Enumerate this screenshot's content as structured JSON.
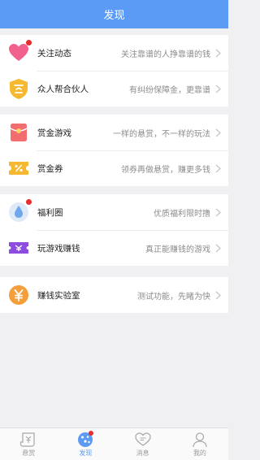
{
  "header": {
    "title": "发现"
  },
  "groups": [
    {
      "items": [
        {
          "title": "关注动态",
          "desc": "关注靠谱的人挣靠谱的钱",
          "icon": "heart-icon",
          "badge": true
        },
        {
          "title": "众人帮合伙人",
          "desc": "有纠纷保障金，更靠谱",
          "icon": "shield-badge-icon",
          "badge": false
        }
      ]
    },
    {
      "items": [
        {
          "title": "赏金游戏",
          "desc": "一样的悬赏，不一样的玩法",
          "icon": "red-envelope-icon",
          "badge": false
        },
        {
          "title": "赏金券",
          "desc": "领券再做悬赏，赚更多钱",
          "icon": "coupon-icon",
          "badge": false
        }
      ]
    },
    {
      "items": [
        {
          "title": "福利圈",
          "desc": "优质福利限时撸",
          "icon": "droplet-icon",
          "badge": true
        },
        {
          "title": "玩游戏赚钱",
          "desc": "真正能赚钱的游戏",
          "icon": "game-ticket-icon",
          "badge": false
        }
      ]
    },
    {
      "items": [
        {
          "title": "赚钱实验室",
          "desc": "测试功能，先睹为快",
          "icon": "yuan-coin-icon",
          "badge": false
        }
      ]
    }
  ],
  "tabbar": {
    "tabs": [
      {
        "label": "悬赏",
        "icon": "scroll-yuan-icon",
        "active": false,
        "badge": false
      },
      {
        "label": "发现",
        "icon": "compass-icon",
        "active": true,
        "badge": true
      },
      {
        "label": "消息",
        "icon": "chat-heart-icon",
        "active": false,
        "badge": false
      },
      {
        "label": "我的",
        "icon": "person-icon",
        "active": false,
        "badge": false
      }
    ]
  },
  "colors": {
    "header": "#5c9bf5",
    "accent": "#5c9bf5",
    "badge": "#e62c2c",
    "heart": "#f2608c",
    "orange": "#f5b82e",
    "envelope": "#f26d6d",
    "droplet": "#6fa8ea",
    "purple": "#8c4ce0",
    "coin": "#f59e3c"
  }
}
